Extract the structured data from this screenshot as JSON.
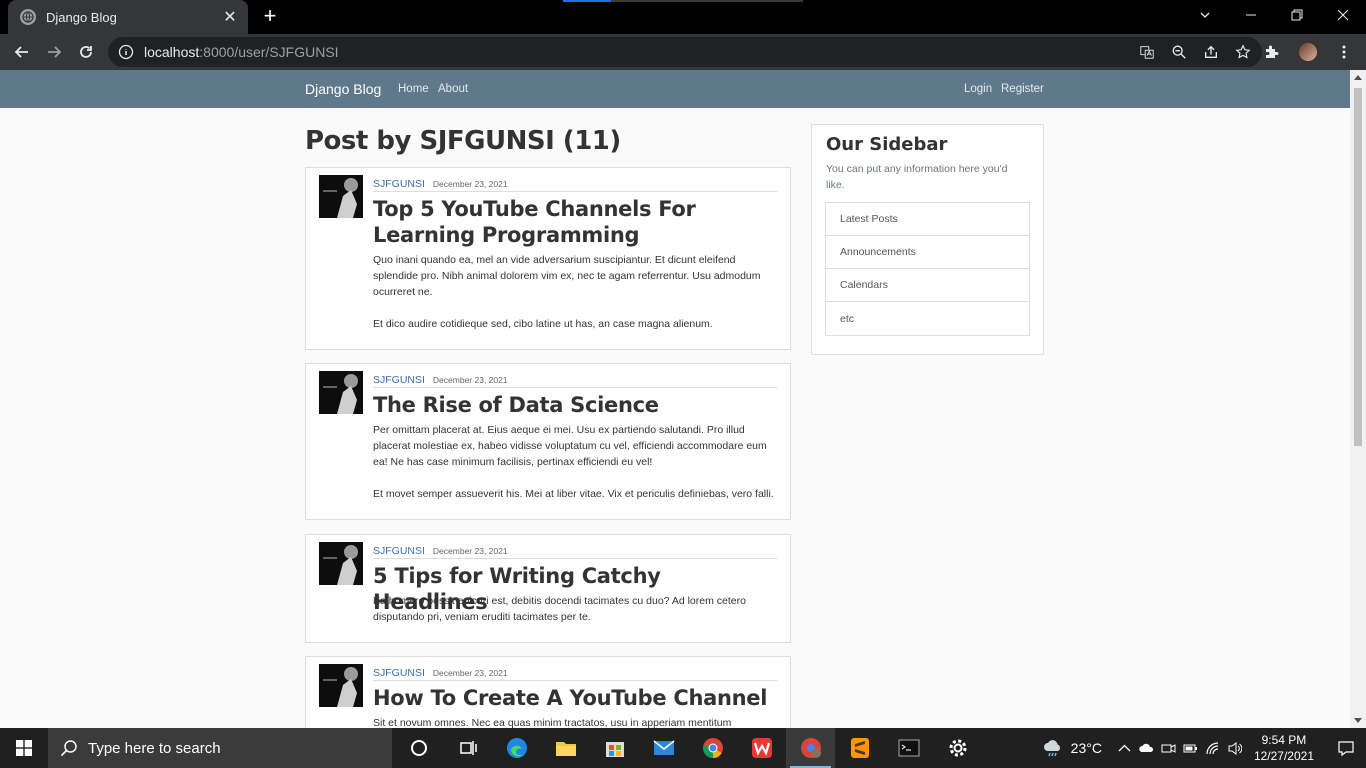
{
  "browser": {
    "tab_title": "Django Blog",
    "url_host": "localhost",
    "url_rest": ":8000/user/SJFGUNSI"
  },
  "navbar": {
    "brand": "Django Blog",
    "links": [
      "Home",
      "About"
    ],
    "auth": [
      "Login",
      "Register"
    ]
  },
  "main": {
    "title": "Post by SJFGUNSI (11)"
  },
  "posts": [
    {
      "author": "SJFGUNSI",
      "date": "December 23, 2021",
      "title": "Top 5 YouTube Channels For Learning Programming",
      "paragraphs": [
        "Quo inani quando ea, mel an vide adversarium suscipiantur. Et dicunt eleifend splendide pro. Nibh animal dolorem vim ex, nec te agam referrentur. Usu admodum ocurreret ne.",
        "Et dico audire cotidieque sed, cibo latine ut has, an case magna alienum."
      ]
    },
    {
      "author": "SJFGUNSI",
      "date": "December 23, 2021",
      "title": "The Rise of Data Science",
      "paragraphs": [
        "Per omittam placerat at. Eius aeque ei mei. Usu ex partiendo salutandi. Pro illud placerat molestiae ex, habeo vidisse voluptatum cu vel, efficiendi accommodare eum ea! Ne has case minimum facilisis, pertinax efficiendi eu vel!",
        "Et movet semper assueverit his. Mei at liber vitae. Vix et periculis definiebas, vero falli."
      ]
    },
    {
      "author": "SJFGUNSI",
      "date": "December 23, 2021",
      "title": "5 Tips for Writing Catchy Headlines",
      "paragraphs": [
        "Ea homero possit epicuri est, debitis docendi tacimates cu duo? Ad lorem cetero disputando pri, veniam eruditi tacimates per te."
      ]
    },
    {
      "author": "SJFGUNSI",
      "date": "December 23, 2021",
      "title": "How To Create A YouTube Channel",
      "paragraphs": [
        "Sit et novum omnes. Nec ea quas minim tractatos, usu in apperiam mentitum"
      ]
    }
  ],
  "sidebar": {
    "title": "Our Sidebar",
    "description": "You can put any information here you'd like.",
    "items": [
      "Latest Posts",
      "Announcements",
      "Calendars",
      "etc"
    ]
  },
  "taskbar": {
    "search_placeholder": "Type here to search",
    "temperature": "23°C",
    "time": "9:54 PM",
    "date": "12/27/2021"
  }
}
